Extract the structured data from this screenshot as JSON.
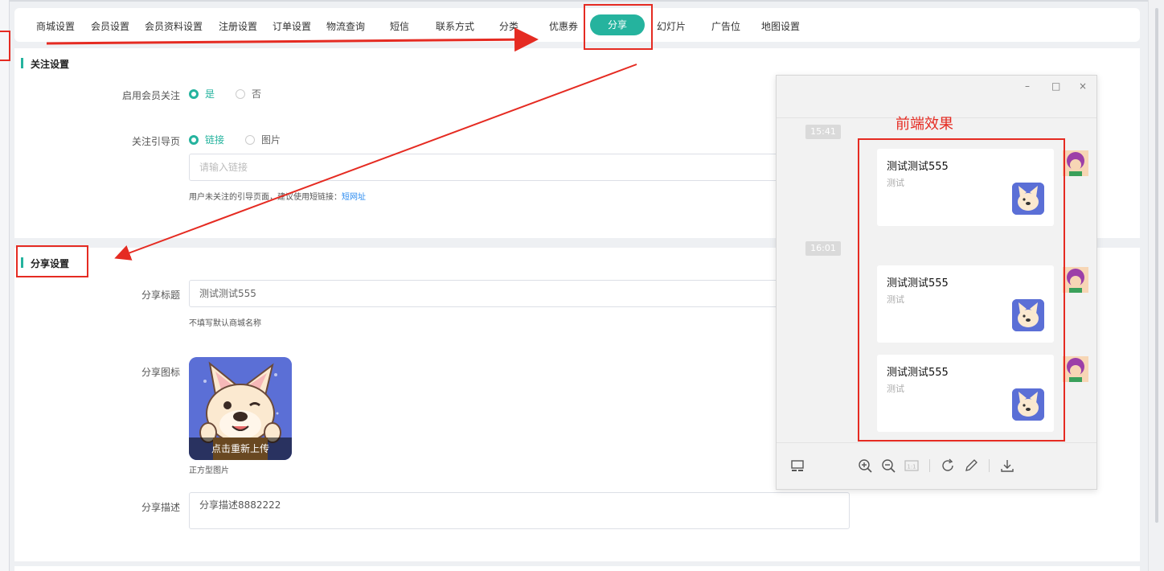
{
  "tabs": [
    {
      "label": "商城设置"
    },
    {
      "label": "会员设置"
    },
    {
      "label": "会员资料设置"
    },
    {
      "label": "注册设置"
    },
    {
      "label": "订单设置"
    },
    {
      "label": "物流查询"
    },
    {
      "label": "短信"
    },
    {
      "label": "联系方式"
    },
    {
      "label": "分类"
    },
    {
      "label": "优惠券"
    },
    {
      "label": "分享"
    },
    {
      "label": "幻灯片"
    },
    {
      "label": "广告位"
    },
    {
      "label": "地图设置"
    }
  ],
  "follow": {
    "title": "关注设置",
    "enable_label": "启用会员关注",
    "yes": "是",
    "no": "否",
    "guide_label": "关注引导页",
    "opt_link": "链接",
    "opt_image": "图片",
    "link_placeholder": "请输入链接",
    "hint_prefix": "用户未关注的引导页面，建议使用短链接：",
    "hint_link": "短网址"
  },
  "share": {
    "title": "分享设置",
    "title_label": "分享标题",
    "title_value": "测试测试555",
    "title_hint": "不填写默认商城名称",
    "icon_label": "分享图标",
    "reupload": "点击重新上传",
    "icon_hint": "正方型图片",
    "desc_label": "分享描述",
    "desc_value": "分享描述8882222"
  },
  "viewer": {
    "annotation": "前端效果",
    "times": [
      "15:41",
      "16:01"
    ],
    "cards": [
      {
        "title": "测试测试555",
        "desc": "测试"
      },
      {
        "title": "测试测试555",
        "desc": "测试"
      },
      {
        "title": "测试测试555",
        "desc": "测试"
      }
    ],
    "window_buttons": {
      "minimize": "–",
      "maximize": "□",
      "close": "×"
    },
    "scale_label": "1:1"
  },
  "colors": {
    "accent": "#25b39e",
    "annotation_red": "#e52b22",
    "link": "#2d8cf0"
  }
}
